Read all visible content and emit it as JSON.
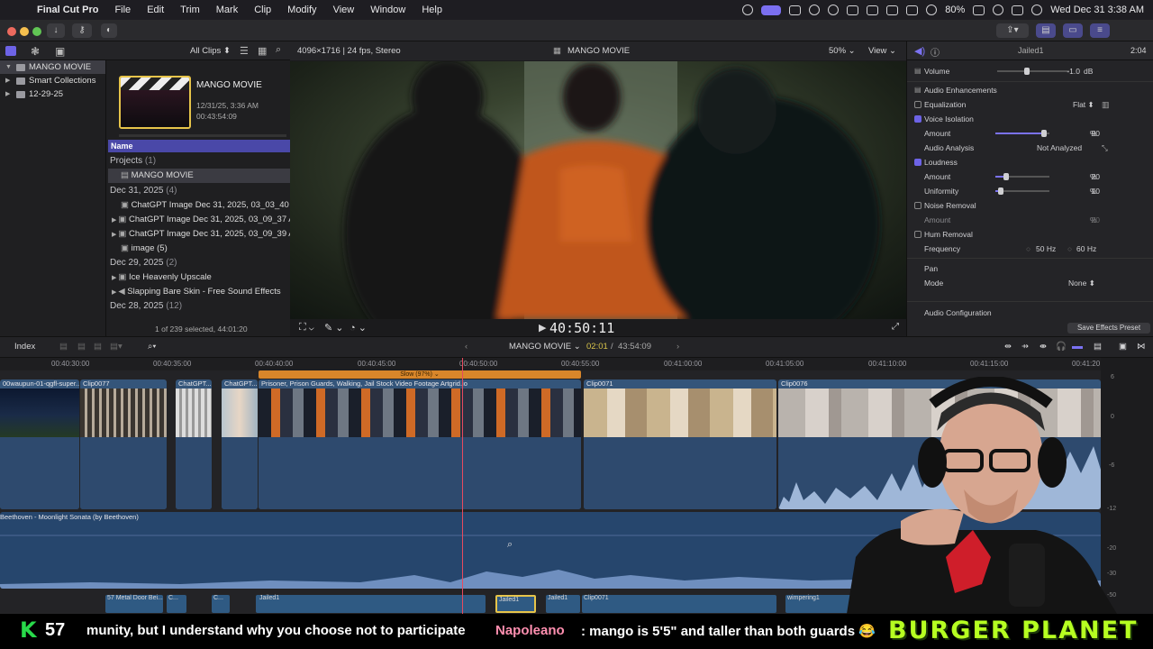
{
  "menubar": {
    "app": "Final Cut Pro",
    "items": [
      "File",
      "Edit",
      "Trim",
      "Mark",
      "Clip",
      "Modify",
      "View",
      "Window",
      "Help"
    ],
    "battery": "80%",
    "datetime": "Wed Dec 31  3:38 AM"
  },
  "browser_header": {
    "filter": "All Clips"
  },
  "libraries": [
    {
      "label": "MANGO MOVIE",
      "selected": true
    },
    {
      "label": "Smart Collections"
    },
    {
      "label": "12-29-25"
    }
  ],
  "event": {
    "name": "MANGO MOVIE",
    "date": "12/31/25, 3:36 AM",
    "duration": "00:43:54:09"
  },
  "selection_status": "1 of 239 selected, 44:01:20",
  "list": {
    "header": "Name",
    "rows": [
      {
        "kind": "group",
        "label": "Projects",
        "count": "(1)"
      },
      {
        "kind": "item",
        "label": "MANGO MOVIE",
        "selected": true
      },
      {
        "kind": "group",
        "label": "Dec 31, 2025",
        "count": "(4)"
      },
      {
        "kind": "item",
        "label": "ChatGPT Image Dec 31, 2025, 03_03_40 A"
      },
      {
        "kind": "item",
        "label": "ChatGPT Image Dec 31, 2025, 03_09_37 AI"
      },
      {
        "kind": "item",
        "label": "ChatGPT Image Dec 31, 2025, 03_09_39 A"
      },
      {
        "kind": "item",
        "label": "image (5)"
      },
      {
        "kind": "group",
        "label": "Dec 29, 2025",
        "count": "(2)"
      },
      {
        "kind": "item",
        "label": "Ice Heavenly Upscale"
      },
      {
        "kind": "item",
        "label": "Slapping Bare Skin - Free Sound Effects"
      },
      {
        "kind": "group",
        "label": "Dec 28, 2025",
        "count": "(12)"
      }
    ]
  },
  "viewer": {
    "format": "4096×1716 | 24 fps, Stereo",
    "title": "MANGO MOVIE",
    "zoom": "50%",
    "view": "View",
    "timecode": "40:50:11"
  },
  "inspector": {
    "clip_name": "Jailed1",
    "clip_duration": "2:04",
    "volume": {
      "label": "Volume",
      "value": "-1.0",
      "unit": "dB",
      "level": 0.6
    },
    "section_enhancements": "Audio Enhancements",
    "equalization": {
      "label": "Equalization",
      "value": "Flat"
    },
    "voice_isolation": {
      "label": "Voice Isolation",
      "checked": true,
      "amount_label": "Amount",
      "amount": "90",
      "unit": "%",
      "level": 0.9
    },
    "audio_analysis": {
      "label": "Audio Analysis",
      "value": "Not Analyzed"
    },
    "loudness": {
      "label": "Loudness",
      "checked": true,
      "amount_label": "Amount",
      "amount": "20",
      "uniformity_label": "Uniformity",
      "uniformity": "10",
      "unit": "%",
      "amount_level": 0.2,
      "uniformity_level": 0.1
    },
    "noise_removal": {
      "label": "Noise Removal",
      "checked": false,
      "amount_label": "Amount",
      "amount": "20",
      "unit": "%"
    },
    "hum_removal": {
      "label": "Hum Removal",
      "checked": false,
      "freq_label": "Frequency",
      "freq1": "50 Hz",
      "freq2": "60 Hz"
    },
    "pan": {
      "label": "Pan",
      "mode_label": "Mode",
      "mode": "None"
    },
    "audio_config": "Audio Configuration",
    "save_preset": "Save Effects Preset"
  },
  "timeline_bar": {
    "index": "Index",
    "project": "MANGO MOVIE",
    "position": "02:01",
    "total": "43:54:09"
  },
  "ruler_ticks": [
    "00:40:30:00",
    "00:40:35:00",
    "00:40:40:00",
    "00:40:45:00",
    "00:40:50:00",
    "00:40:55:00",
    "00:41:00:00",
    "00:41:05:00",
    "00:41:10:00",
    "00:41:15:00",
    "00:41:20"
  ],
  "retime_label": "Slow (97%)",
  "clips": [
    {
      "label": "00waupun-01-qgfl-super..."
    },
    {
      "label": "Clip0077"
    },
    {
      "label": "ChatGPT..."
    },
    {
      "label": "ChatGPT..."
    },
    {
      "label": "Prisoner, Prison Guards, Walking, Jail  Stock Video Footage   Artgrid.io"
    },
    {
      "label": "Clip0071"
    },
    {
      "label": "Clip0076"
    }
  ],
  "music_clip": "Beethoven - Moonlight Sonata (by Beethoven)",
  "sfx_clips": [
    "57 Metal Door Bei...",
    "C...",
    "C...",
    "Jailed1",
    "Jailed1",
    "Jailed1",
    "Clip0071",
    "wimpering1"
  ],
  "meter_scale": [
    "6",
    "0",
    "-6",
    "-12",
    "-20",
    "-30",
    "-50"
  ],
  "chat": {
    "badge": "K",
    "badge_count": "57",
    "message_tail": "munity, but I understand why you choose not to participate",
    "username": "Napoleano",
    "message": ": mango is 5'5\" and taller than both guards 😂",
    "sponsor": "BURGER  PLANET"
  }
}
